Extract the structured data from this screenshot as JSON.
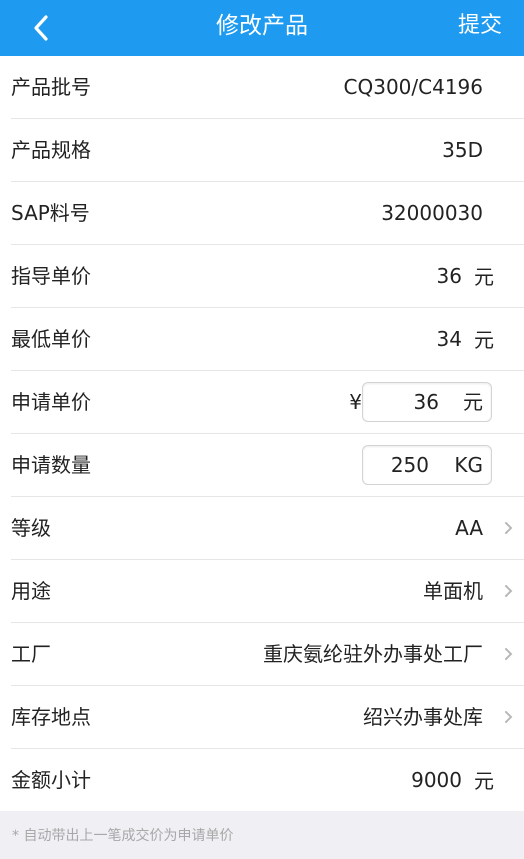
{
  "nav": {
    "title": "修改产品",
    "submit": "提交"
  },
  "rows": {
    "batch": {
      "label": "产品批号",
      "value": "CQ300/C4196"
    },
    "spec": {
      "label": "产品规格",
      "value": "35D"
    },
    "sap": {
      "label": "SAP料号",
      "value": "32000030"
    },
    "guide_price": {
      "label": "指导单价",
      "value": "36",
      "unit": "元"
    },
    "min_price": {
      "label": "最低单价",
      "value": "34",
      "unit": "元"
    },
    "apply_price": {
      "label": "申请单价",
      "currency": "¥",
      "value": "36",
      "unit": "元"
    },
    "apply_qty": {
      "label": "申请数量",
      "value": "250",
      "unit": "KG"
    },
    "grade": {
      "label": "等级",
      "value": "AA"
    },
    "usage": {
      "label": "用途",
      "value": "单面机"
    },
    "factory": {
      "label": "工厂",
      "value": "重庆氨纶驻外办事处工厂"
    },
    "location": {
      "label": "库存地点",
      "value": "绍兴办事处库"
    },
    "subtotal": {
      "label": "金额小计",
      "value": "9000",
      "unit": "元"
    }
  },
  "note": "* 自动带出上一笔成交价为申请单价"
}
